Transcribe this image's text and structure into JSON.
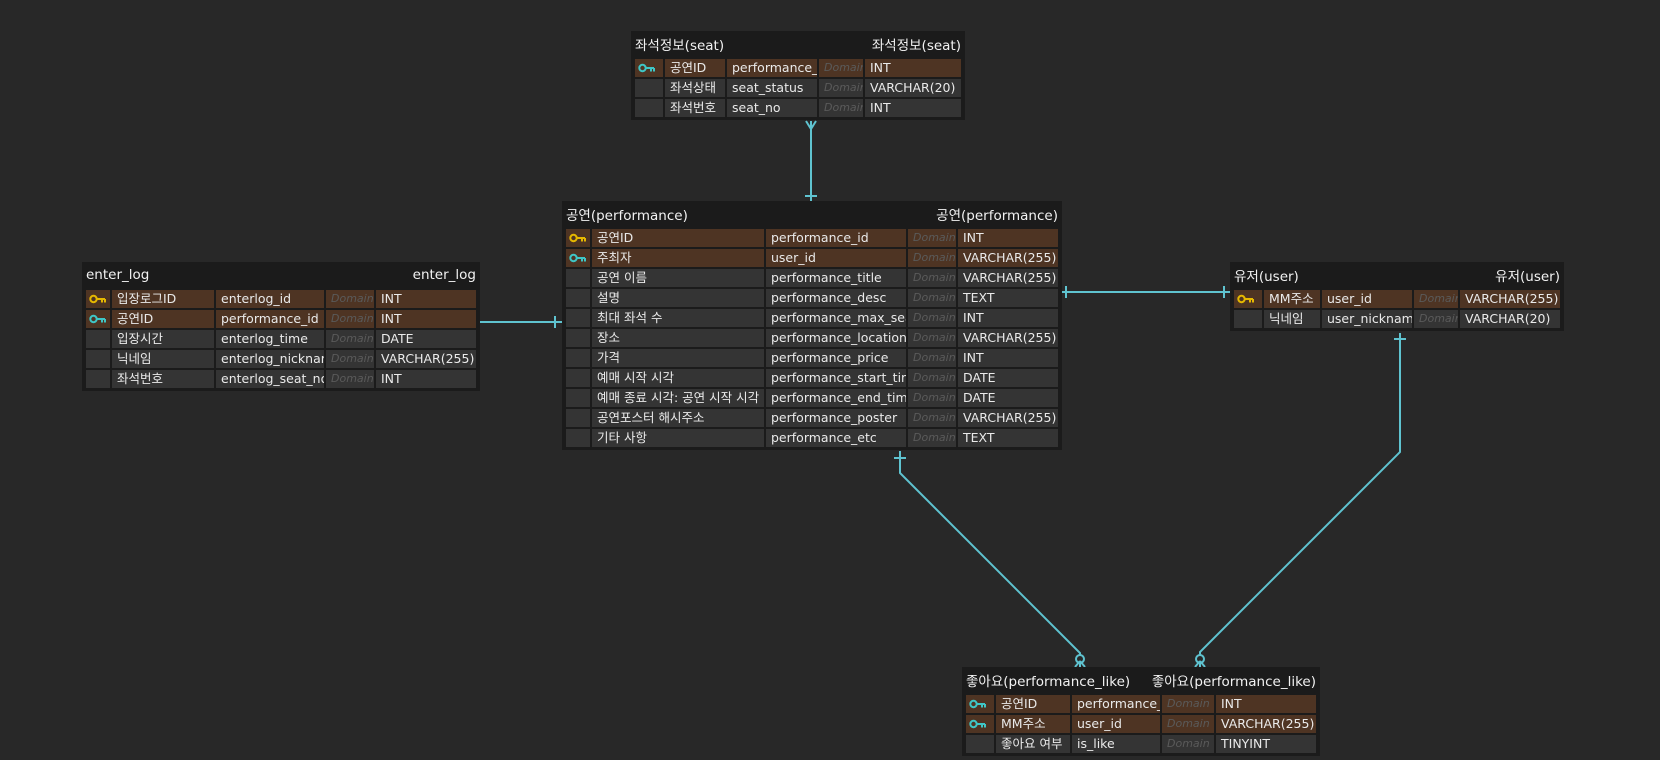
{
  "colors": {
    "background": "#282828",
    "table_bg": "#1b1b1b",
    "row_bg": "#343434",
    "key_row_bg": "#4e3423",
    "primary_key_icon": "#e6b800",
    "foreign_key_icon": "#3fc6c6",
    "relation_line": "#5fc3d0"
  },
  "entities": {
    "seat": {
      "title_left": "좌석정보(seat)",
      "title_right": "좌석정보(seat)",
      "columns": [
        {
          "key": "fk-icon",
          "logical": "공연ID",
          "physical": "performance_id",
          "domain": "Domain",
          "type": "INT",
          "highlight": true
        },
        {
          "key": "",
          "logical": "좌석상태",
          "physical": "seat_status",
          "domain": "Domain",
          "type": "VARCHAR(20)",
          "highlight": false
        },
        {
          "key": "",
          "logical": "좌석번호",
          "physical": "seat_no",
          "domain": "Domain",
          "type": "INT",
          "highlight": false
        }
      ]
    },
    "performance": {
      "title_left": "공연(performance)",
      "title_right": "공연(performance)",
      "columns": [
        {
          "key": "pk-icon",
          "logical": "공연ID",
          "physical": "performance_id",
          "domain": "Domain",
          "type": "INT",
          "highlight": true
        },
        {
          "key": "fk-icon",
          "logical": "주최자",
          "physical": "user_id",
          "domain": "Domain",
          "type": "VARCHAR(255)",
          "highlight": true
        },
        {
          "key": "",
          "logical": "공연 이름",
          "physical": "performance_title",
          "domain": "Domain",
          "type": "VARCHAR(255)",
          "highlight": false
        },
        {
          "key": "",
          "logical": "설명",
          "physical": "performance_desc",
          "domain": "Domain",
          "type": "TEXT",
          "highlight": false
        },
        {
          "key": "",
          "logical": "최대 좌석 수",
          "physical": "performance_max_seats",
          "domain": "Domain",
          "type": "INT",
          "highlight": false
        },
        {
          "key": "",
          "logical": "장소",
          "physical": "performance_location",
          "domain": "Domain",
          "type": "VARCHAR(255)",
          "highlight": false
        },
        {
          "key": "",
          "logical": "가격",
          "physical": "performance_price",
          "domain": "Domain",
          "type": "INT",
          "highlight": false
        },
        {
          "key": "",
          "logical": "예매 시작 시각",
          "physical": "performance_start_time",
          "domain": "Domain",
          "type": "DATE",
          "highlight": false
        },
        {
          "key": "",
          "logical": "예매 종료 시각: 공연 시작 시각",
          "physical": "performance_end_time",
          "domain": "Domain",
          "type": "DATE",
          "highlight": false
        },
        {
          "key": "",
          "logical": "공연포스터 해시주소",
          "physical": "performance_poster",
          "domain": "Domain",
          "type": "VARCHAR(255)",
          "highlight": false
        },
        {
          "key": "",
          "logical": "기타 사항",
          "physical": "performance_etc",
          "domain": "Domain",
          "type": "TEXT",
          "highlight": false
        }
      ]
    },
    "enter_log": {
      "title_left": "enter_log",
      "title_right": "enter_log",
      "columns": [
        {
          "key": "pk-icon",
          "logical": "입장로그ID",
          "physical": "enterlog_id",
          "domain": "Domain",
          "type": "INT",
          "highlight": true
        },
        {
          "key": "fk-icon",
          "logical": "공연ID",
          "physical": "performance_id",
          "domain": "Domain",
          "type": "INT",
          "highlight": true
        },
        {
          "key": "",
          "logical": "입장시간",
          "physical": "enterlog_time",
          "domain": "Domain",
          "type": "DATE",
          "highlight": false
        },
        {
          "key": "",
          "logical": "닉네임",
          "physical": "enterlog_nickname",
          "domain": "Domain",
          "type": "VARCHAR(255)",
          "highlight": false
        },
        {
          "key": "",
          "logical": "좌석번호",
          "physical": "enterlog_seat_no",
          "domain": "Domain",
          "type": "INT",
          "highlight": false
        }
      ]
    },
    "user": {
      "title_left": "유저(user)",
      "title_right": "유저(user)",
      "columns": [
        {
          "key": "pk-icon",
          "logical": "MM주소",
          "physical": "user_id",
          "domain": "Domain",
          "type": "VARCHAR(255)",
          "highlight": true
        },
        {
          "key": "",
          "logical": "닉네임",
          "physical": "user_nickname",
          "domain": "Domain",
          "type": "VARCHAR(20)",
          "highlight": false
        }
      ]
    },
    "performance_like": {
      "title_left": "좋아요(performance_like)",
      "title_right": "좋아요(performance_like)",
      "columns": [
        {
          "key": "fk-icon",
          "logical": "공연ID",
          "physical": "performance_id",
          "domain": "Domain",
          "type": "INT",
          "highlight": true
        },
        {
          "key": "fk-icon",
          "logical": "MM주소",
          "physical": "user_id",
          "domain": "Domain",
          "type": "VARCHAR(255)",
          "highlight": true
        },
        {
          "key": "",
          "logical": "좋아요 여부",
          "physical": "is_like",
          "domain": "Domain",
          "type": "TINYINT",
          "highlight": false
        }
      ]
    }
  },
  "relationships": [
    {
      "from": "performance",
      "to": "seat",
      "from_end": "one",
      "to_end": "many"
    },
    {
      "from": "performance",
      "to": "enter_log",
      "from_end": "one",
      "to_end": "zero-or-many"
    },
    {
      "from": "user",
      "to": "performance",
      "from_end": "one",
      "to_end": "one"
    },
    {
      "from": "performance",
      "to": "performance_like",
      "from_end": "one",
      "to_end": "zero-or-many"
    },
    {
      "from": "user",
      "to": "performance_like",
      "from_end": "one",
      "to_end": "zero-or-many"
    }
  ]
}
